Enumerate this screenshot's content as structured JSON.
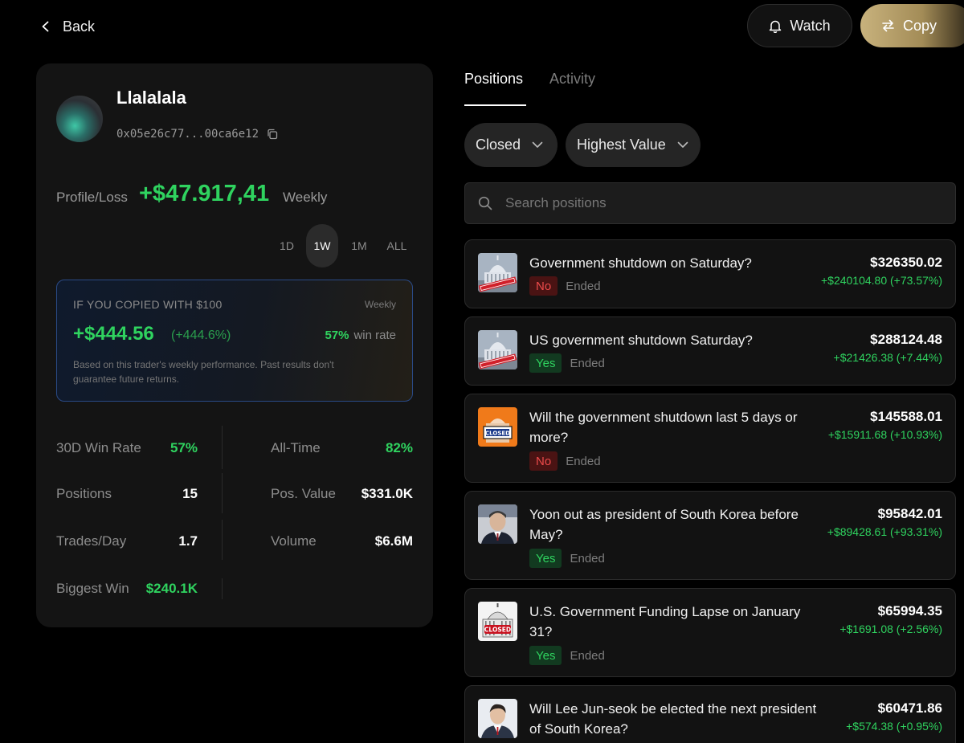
{
  "header": {
    "back_label": "Back",
    "watch_label": "Watch",
    "copy_label": "Copy"
  },
  "profile": {
    "username": "Llalalala",
    "address": "0x05e26c77...00ca6e12",
    "pl_label": "Profile/Loss",
    "pl_value": "+$47.917,41",
    "pl_period": "Weekly",
    "ranges": [
      "1D",
      "1W",
      "1M",
      "ALL"
    ],
    "active_range": "1W"
  },
  "copied": {
    "title": "IF YOU COPIED WITH $100",
    "period": "Weekly",
    "amount": "+$444.56",
    "percent": "(+444.6%)",
    "win_rate_value": "57%",
    "win_rate_label": "win rate",
    "note": "Based on this trader's weekly performance. Past results don't guarantee future returns."
  },
  "stats": [
    {
      "label": "30D Win Rate",
      "value": "57%",
      "green": true
    },
    {
      "label": "All-Time",
      "value": "82%",
      "green": true
    },
    {
      "label": "Positions",
      "value": "15",
      "green": false
    },
    {
      "label": "Pos. Value",
      "value": "$331.0K",
      "green": false
    },
    {
      "label": "Trades/Day",
      "value": "1.7",
      "green": false
    },
    {
      "label": "Volume",
      "value": "$6.6M",
      "green": false
    },
    {
      "label": "Biggest Win",
      "value": "$240.1K",
      "green": true
    }
  ],
  "tabs": [
    {
      "label": "Positions",
      "active": true
    },
    {
      "label": "Activity",
      "active": false
    }
  ],
  "filters": {
    "status": "Closed",
    "sort": "Highest Value"
  },
  "search": {
    "placeholder": "Search positions",
    "value": ""
  },
  "positions": [
    {
      "title": "Government shutdown on Saturday?",
      "outcome": "No",
      "status": "Ended",
      "value": "$326350.02",
      "change": "+$240104.80  (+73.57%)",
      "icon": "capitol-closed-icon"
    },
    {
      "title": "US government shutdown Saturday?",
      "outcome": "Yes",
      "status": "Ended",
      "value": "$288124.48",
      "change": "+$21426.38  (+7.44%)",
      "icon": "capitol-closed-icon"
    },
    {
      "title": "Will the government shutdown last 5 days or more?",
      "outcome": "No",
      "status": "Ended",
      "value": "$145588.01",
      "change": "+$15911.68  (+10.93%)",
      "icon": "closed-sign-icon"
    },
    {
      "title": "Yoon out as president of South Korea before May?",
      "outcome": "Yes",
      "status": "Ended",
      "value": "$95842.01",
      "change": "+$89428.61  (+93.31%)",
      "icon": "person-portrait-icon"
    },
    {
      "title": "U.S. Government Funding Lapse on January 31?",
      "outcome": "Yes",
      "status": "Ended",
      "value": "$65994.35",
      "change": "+$1691.08  (+2.56%)",
      "icon": "capitol-closed-icon"
    },
    {
      "title": "Will Lee Jun-seok be elected the next president of South Korea?",
      "outcome": "",
      "status": "",
      "value": "$60471.86",
      "change": "+$574.38  (+0.95%)",
      "icon": "person-portrait-icon"
    }
  ],
  "colors": {
    "positive": "#2fd35f",
    "negative": "#ee4b4b",
    "accent_gold": "#c8b27d",
    "background": "#000000",
    "card": "#141414"
  }
}
